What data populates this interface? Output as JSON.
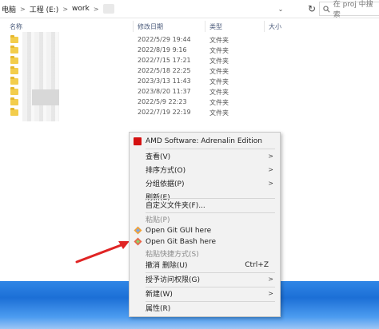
{
  "address": {
    "crumbs": [
      "电脑",
      "工程 (E:)",
      "work"
    ],
    "search_placeholder": "在 proj 中搜索"
  },
  "columns": {
    "name": "名称",
    "date": "修改日期",
    "type": "类型",
    "size": "大小"
  },
  "files": [
    {
      "date": "2022/5/29 19:44",
      "type": "文件夹"
    },
    {
      "date": "2022/8/19 9:16",
      "type": "文件夹"
    },
    {
      "date": "2022/7/15 17:21",
      "type": "文件夹"
    },
    {
      "date": "2022/5/18 22:25",
      "type": "文件夹"
    },
    {
      "date": "2023/3/13 11:43",
      "type": "文件夹"
    },
    {
      "date": "2023/8/20 11:37",
      "type": "文件夹"
    },
    {
      "date": "2022/5/9 22:23",
      "type": "文件夹"
    },
    {
      "date": "2022/7/19 22:19",
      "type": "文件夹"
    }
  ],
  "menu": {
    "amd": "AMD Software: Adrenalin Edition",
    "view": "查看(V)",
    "sort": "排序方式(O)",
    "group": "分组依据(P)",
    "refresh": "刷新(E)",
    "customize": "自定义文件夹(F)...",
    "paste": "粘贴(P)",
    "git_gui": "Open Git GUI here",
    "git_bash": "Open Git Bash here",
    "paste_shortcut": "粘贴快捷方式(S)",
    "undo_delete": "撤消 删除(U)",
    "undo_shortcut": "Ctrl+Z",
    "grant_access": "授予访问权限(G)",
    "new": "新建(W)",
    "properties": "属性(R)"
  },
  "colors": {
    "amd_red": "#d41010",
    "folder": "#f3cd4c",
    "arrow": "#e02424",
    "taskbar": "#1c6fd6"
  }
}
